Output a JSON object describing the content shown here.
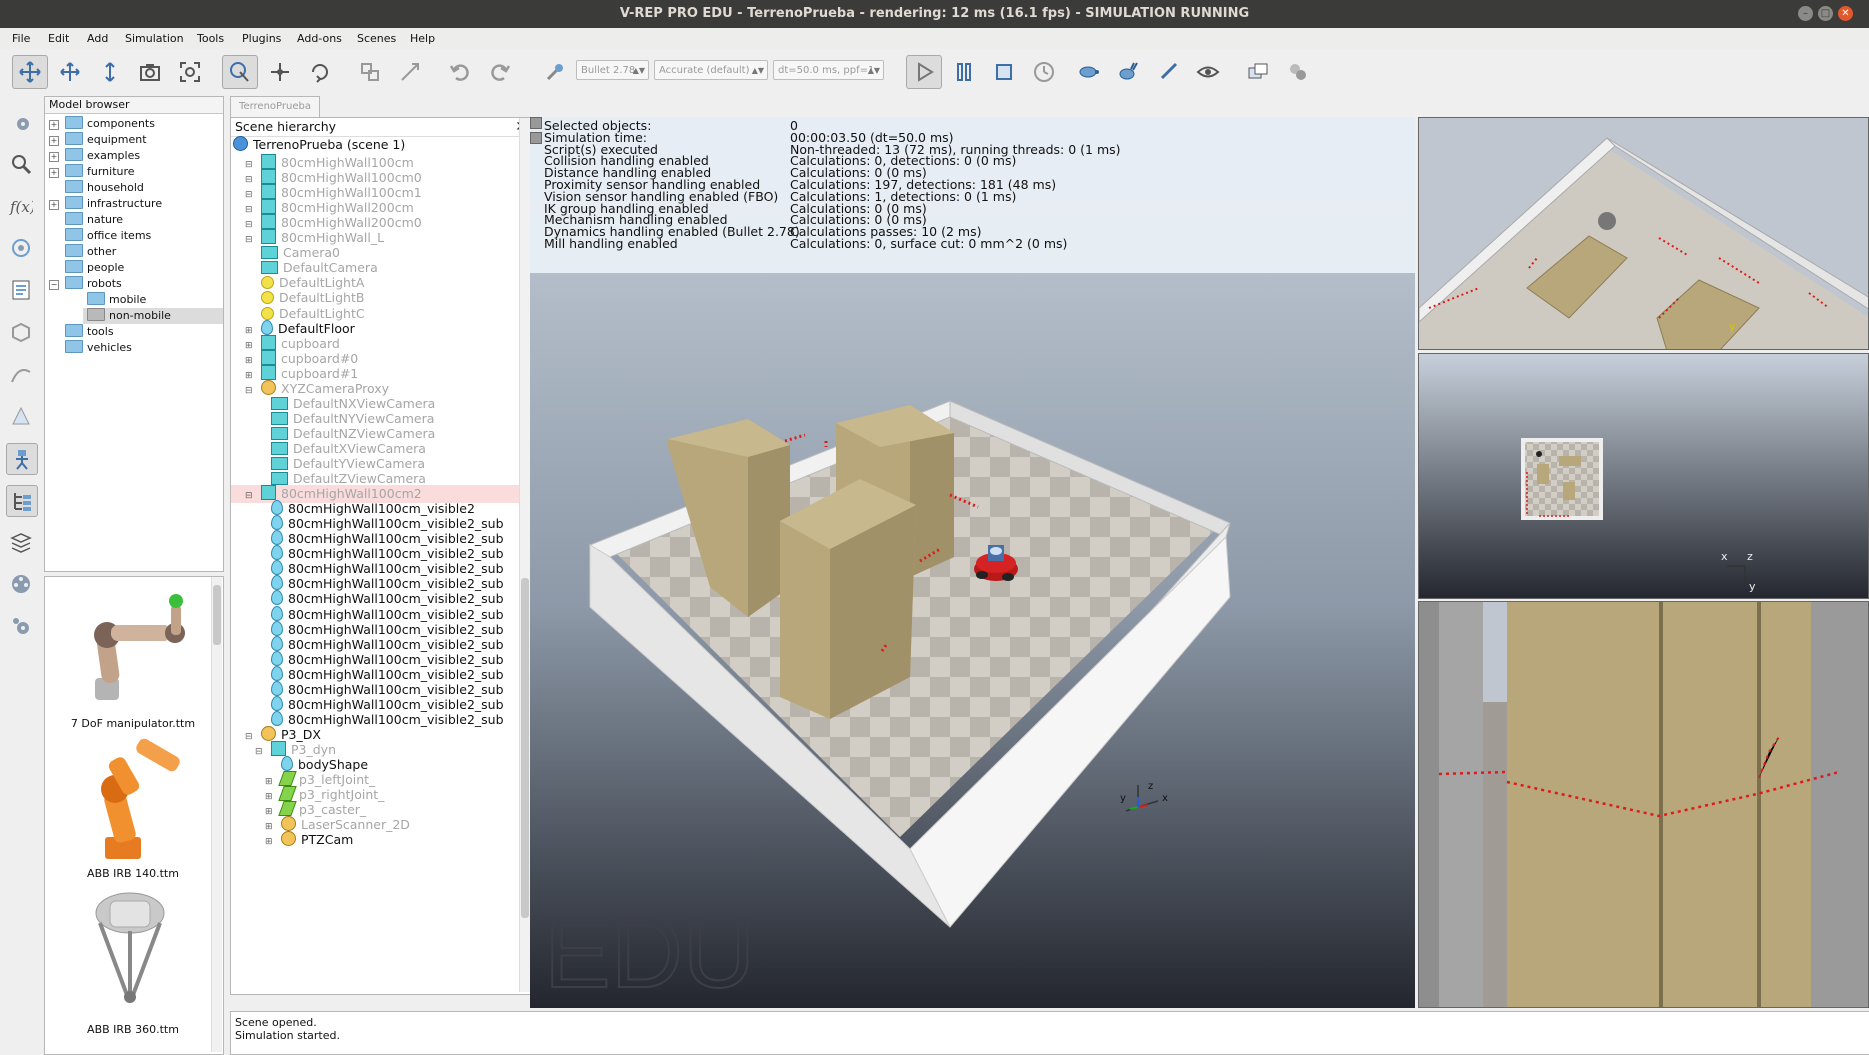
{
  "window": {
    "title": "V-REP PRO EDU - TerrenoPrueba - rendering: 12 ms (16.1 fps) - SIMULATION RUNNING"
  },
  "menu": [
    "File",
    "Edit",
    "Add",
    "Simulation",
    "Tools",
    "Plugins",
    "Add-ons",
    "Scenes",
    "Help"
  ],
  "toolbar": {
    "engine": "Bullet 2.78",
    "accuracy": "Accurate (default)",
    "timestep": "dt=50.0 ms, ppf=1"
  },
  "model_browser": {
    "title": "Model browser",
    "folders": [
      "components",
      "equipment",
      "examples",
      "furniture",
      "household",
      "infrastructure",
      "nature",
      "office items",
      "other",
      "people",
      "robots",
      "mobile",
      "non-mobile",
      "tools",
      "vehicles"
    ],
    "thumbnails": [
      "7 DoF manipulator.ttm",
      "ABB IRB 140.ttm",
      "ABB IRB 360.ttm"
    ]
  },
  "scene_tab": "TerrenoPrueba",
  "scene_hierarchy": {
    "title": "Scene hierarchy",
    "root": "TerrenoPrueba (scene 1)",
    "items": [
      "80cmHighWall100cm",
      "80cmHighWall100cm0",
      "80cmHighWall100cm1",
      "80cmHighWall200cm",
      "80cmHighWall200cm0",
      "80cmHighWall_L",
      "Camera0",
      "DefaultCamera",
      "DefaultLightA",
      "DefaultLightB",
      "DefaultLightC",
      "DefaultFloor",
      "cupboard",
      "cupboard#0",
      "cupboard#1",
      "XYZCameraProxy",
      "DefaultNXViewCamera",
      "DefaultNYViewCamera",
      "DefaultNZViewCamera",
      "DefaultXViewCamera",
      "DefaultYViewCamera",
      "DefaultZViewCamera",
      "80cmHighWall100cm2",
      "80cmHighWall100cm_visible2",
      "80cmHighWall100cm_visible2_sub",
      "80cmHighWall100cm_visible2_sub",
      "80cmHighWall100cm_visible2_sub",
      "80cmHighWall100cm_visible2_sub",
      "80cmHighWall100cm_visible2_sub",
      "80cmHighWall100cm_visible2_sub",
      "80cmHighWall100cm_visible2_sub",
      "80cmHighWall100cm_visible2_sub",
      "80cmHighWall100cm_visible2_sub",
      "80cmHighWall100cm_visible2_sub",
      "80cmHighWall100cm_visible2_sub",
      "80cmHighWall100cm_visible2_sub",
      "80cmHighWall100cm_visible2_sub",
      "80cmHighWall100cm_visible2_sub",
      "P3_DX",
      "P3_dyn",
      "bodyShape",
      "p3_leftJoint_",
      "p3_rightJoint_",
      "p3_caster_",
      "LaserScanner_2D",
      "PTZCam"
    ]
  },
  "info": {
    "labels": [
      "Selected objects:",
      "Simulation time:",
      "Script(s) executed",
      "Collision handling enabled",
      "Distance handling enabled",
      "Proximity sensor handling enabled",
      "Vision sensor handling enabled (FBO)",
      "IK group handling enabled",
      "Mechanism handling enabled",
      "Dynamics handling enabled (Bullet 2.78)",
      "Mill handling enabled"
    ],
    "values": [
      "0",
      "00:00:03.50 (dt=50.0 ms)",
      "Non-threaded: 13 (72 ms), running threads: 0 (1 ms)",
      "Calculations: 0, detections: 0 (0 ms)",
      "Calculations: 0 (0 ms)",
      "Calculations: 197, detections: 181 (48 ms)",
      "Calculations: 1, detections: 0 (1 ms)",
      "Calculations: 0 (0 ms)",
      "Calculations: 0 (0 ms)",
      "Calculations passes: 10 (2 ms)",
      "Calculations: 0, surface cut: 0 mm^2 (0 ms)"
    ]
  },
  "watermark": "EDU",
  "axis_labels": {
    "x": "x",
    "y": "y",
    "z": "z"
  },
  "status": [
    "Scene opened.",
    "Simulation started."
  ],
  "colors": {
    "titlebar": "#3b3b39",
    "accent_red": "#e01a1a",
    "cupboard": "#b5a57a",
    "floor": "#d7d3cc"
  }
}
